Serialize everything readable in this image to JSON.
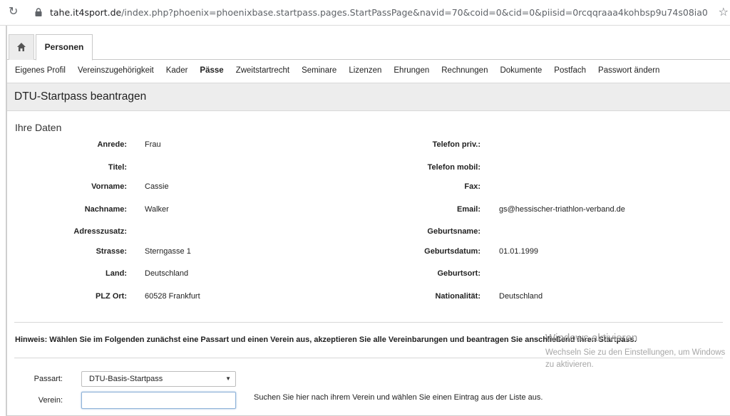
{
  "browser": {
    "url_host": "tahe.it4sport.de",
    "url_path": "/index.php?phoenix=phoenixbase.startpass.pages.StartPassPage&navid=70&coid=0&cid=0&piisid=0rcqqraaa4kohbsp9u74s08ia0",
    "reload_icon": "reload-icon",
    "lock_icon": "lock-icon",
    "star_icon": "star-icon"
  },
  "tabs": {
    "home_icon": "home-icon",
    "active": "Personen"
  },
  "subnav": [
    {
      "label": "Eigenes Profil"
    },
    {
      "label": "Vereinszugehörigkeit"
    },
    {
      "label": "Kader"
    },
    {
      "label": "Pässe"
    },
    {
      "label": "Zweitstartrecht"
    },
    {
      "label": "Seminare"
    },
    {
      "label": "Lizenzen"
    },
    {
      "label": "Ehrungen"
    },
    {
      "label": "Rechnungen"
    },
    {
      "label": "Dokumente"
    },
    {
      "label": "Postfach"
    },
    {
      "label": "Passwort ändern"
    }
  ],
  "page_title": "DTU-Startpass beantragen",
  "section_title": "Ihre Daten",
  "left_fields": [
    {
      "label": "Anrede:",
      "value": "Frau"
    },
    {
      "label": "Titel:",
      "value": ""
    },
    {
      "label": "Vorname:",
      "value": "Cassie"
    },
    {
      "label": "Nachname:",
      "value": "Walker"
    },
    {
      "label": "Adresszusatz:",
      "value": ""
    },
    {
      "label": "Strasse:",
      "value": "Sterngasse 1"
    },
    {
      "label": "Land:",
      "value": "Deutschland"
    },
    {
      "label": "PLZ Ort:",
      "value": "60528 Frankfurt"
    }
  ],
  "right_fields": [
    {
      "label": "Telefon priv.:",
      "value": ""
    },
    {
      "label": "Telefon mobil:",
      "value": ""
    },
    {
      "label": "Fax:",
      "value": ""
    },
    {
      "label": "Email:",
      "value": "gs@hessischer-triathlon-verband.de"
    },
    {
      "label": "Geburtsname:",
      "value": ""
    },
    {
      "label": "Geburtsdatum:",
      "value": "01.01.1999"
    },
    {
      "label": "Geburtsort:",
      "value": ""
    },
    {
      "label": "Nationalität:",
      "value": "Deutschland"
    }
  ],
  "hint": "Hinweis: Wählen Sie im Folgenden zunächst eine Passart und einen Verein aus, akzeptieren Sie alle Vereinbarungen und beantragen Sie anschließend ihren Startpass.",
  "form": {
    "passart_label": "Passart:",
    "passart_value": "DTU-Basis-Startpass",
    "verein_label": "Verein:",
    "verein_value": "",
    "verein_help": "Suchen Sie hier nach ihrem Verein und wählen Sie einen Eintrag aus der Liste aus."
  },
  "watermark": {
    "title": "Windows aktivieren",
    "text": "Wechseln Sie zu den Einstellungen, um Windows zu aktivieren."
  }
}
